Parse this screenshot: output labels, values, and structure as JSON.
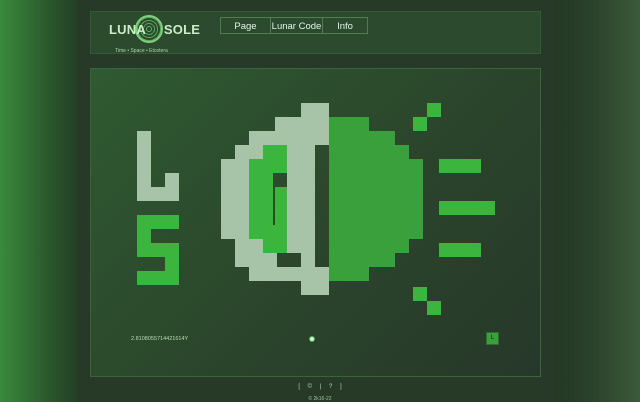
{
  "header": {
    "logo_left": "LUNA",
    "logo_right": "SOLE",
    "tagline": "Time • Space • Etcetera"
  },
  "nav": {
    "items": [
      {
        "label": "Page"
      },
      {
        "label": "Lunar Code"
      },
      {
        "label": "Info"
      }
    ]
  },
  "panel": {
    "coordinate": "2.8108055714421614Y",
    "corner_button": "L"
  },
  "footer": {
    "links": [
      "[",
      "©",
      "|",
      "?",
      "]"
    ],
    "note": "© 2k16-22"
  },
  "colors": {
    "moon": "#a8c4a8",
    "sun": "#3aa03c",
    "bright_green": "#3cb53e",
    "background": "#1f3520"
  },
  "icons": [
    "luna-sole-logo-icon",
    "location-marker-icon"
  ]
}
